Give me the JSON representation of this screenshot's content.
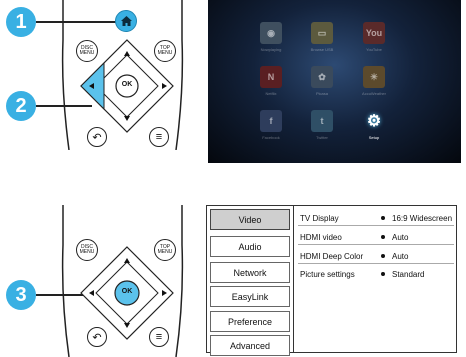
{
  "steps": {
    "one": "1",
    "two": "2",
    "three": "3"
  },
  "remote_top": {
    "disc_menu": "DISC MENU",
    "top_menu": "TOP MENU",
    "ok": "OK",
    "back_icon": "back-arrow-icon",
    "options_icon": "menu-lines-icon",
    "home_icon": "home-icon"
  },
  "remote_bottom": {
    "disc_menu": "DISC MENU",
    "top_menu": "TOP MENU",
    "ok": "OK"
  },
  "tv_tiles": [
    {
      "label": "Nowplaying",
      "glyph": "◉",
      "color": "#3f4f5f"
    },
    {
      "label": "Browse USB",
      "glyph": "▭",
      "color": "#5c5a3e"
    },
    {
      "label": "YouTube",
      "glyph": "You",
      "color": "#5a2a2a"
    },
    {
      "label": "Netflix",
      "glyph": "N",
      "color": "#5a1f22"
    },
    {
      "label": "Picasa",
      "glyph": "✿",
      "color": "#3a4a5c"
    },
    {
      "label": "AccuWeather",
      "glyph": "☀",
      "color": "#5c4a2c"
    },
    {
      "label": "Facebook",
      "glyph": "f",
      "color": "#2e3d5c"
    },
    {
      "label": "Twitter",
      "glyph": "t",
      "color": "#2f4f66"
    },
    {
      "label": "Setup",
      "glyph": "⚙",
      "color": "#1e6fa8"
    }
  ],
  "menu": {
    "items": [
      "Video",
      "Audio",
      "Network",
      "EasyLink",
      "Preference",
      "Advanced"
    ],
    "selected": "Video",
    "settings": [
      {
        "label": "TV Display",
        "value": "16:9 Widescreen"
      },
      {
        "label": "HDMI video",
        "value": "Auto"
      },
      {
        "label": "HDMI Deep Color",
        "value": "Auto"
      },
      {
        "label": "Picture settings",
        "value": "Standard"
      }
    ]
  },
  "colors": {
    "accent": "#39b0e3",
    "highlight": "#5bc2ec"
  }
}
